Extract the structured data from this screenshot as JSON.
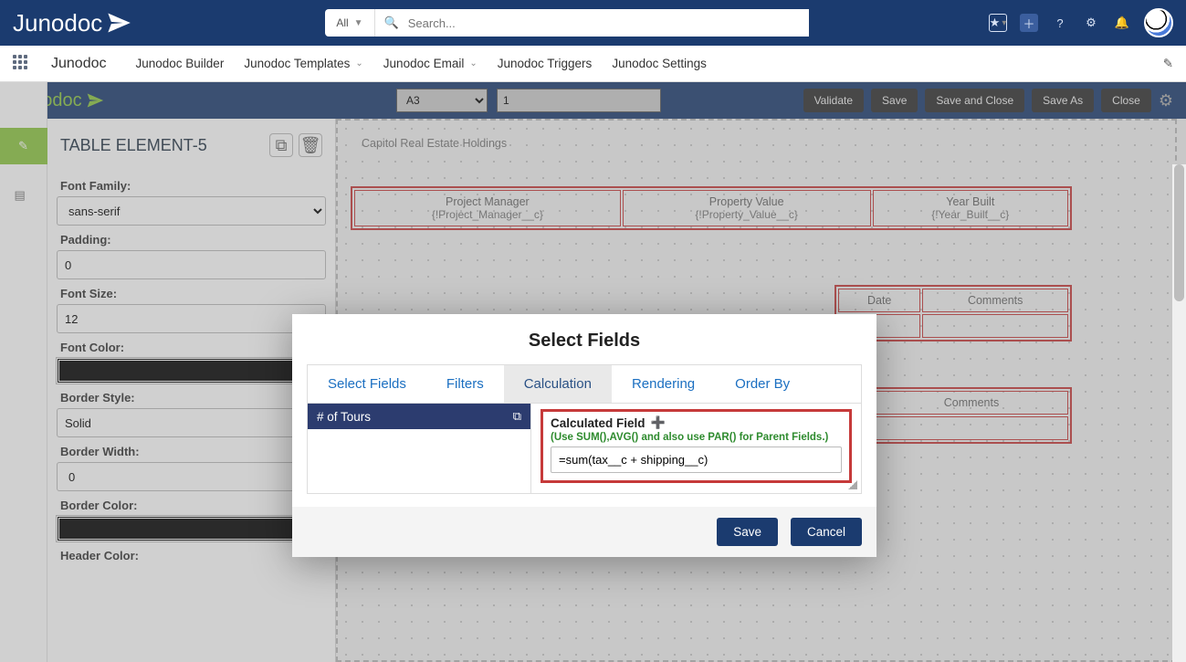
{
  "topbar": {
    "brand": "Junodoc",
    "search_scope": "All",
    "search_placeholder": "Search..."
  },
  "navbar2": {
    "brand": "Junodoc",
    "items": [
      "Junodoc Builder",
      "Junodoc Templates",
      "Junodoc Email",
      "Junodoc Triggers",
      "Junodoc Settings"
    ]
  },
  "strip": {
    "doc_brand": "Junodoc",
    "cell_ref": "A3",
    "cell_value": "1",
    "buttons": {
      "validate": "Validate",
      "save": "Save",
      "save_close": "Save and Close",
      "save_as": "Save As",
      "close": "Close"
    }
  },
  "panel": {
    "title": "TABLE ELEMENT-5",
    "font_family_label": "Font Family:",
    "font_family_value": "sans-serif",
    "padding_label": "Padding:",
    "padding_value": "0",
    "font_size_label": "Font Size:",
    "font_size_value": "12",
    "font_color_label": "Font Color:",
    "border_style_label": "Border Style:",
    "border_style_value": "Solid",
    "border_width_label": "Border Width:",
    "border_width_value": "0",
    "border_color_label": "Border Color:",
    "header_color_label": "Header Color:"
  },
  "canvas": {
    "caption": "Capitol Real Estate Holdings",
    "cols": [
      {
        "h": "Project Manager",
        "s": "{!Project_Manager__c}"
      },
      {
        "h": "Property Value",
        "s": "{!Property_Value__c}"
      },
      {
        "h": "Year Built",
        "s": "{!Year_Built__c}"
      }
    ],
    "row2": {
      "date": "Date",
      "comments": "Comments"
    },
    "row3": {
      "comments": "Comments"
    }
  },
  "modal": {
    "title": "Select Fields",
    "tabs": [
      "Select Fields",
      "Filters",
      "Calculation",
      "Rendering",
      "Order By"
    ],
    "field_name": "# of Tours",
    "calc_label": "Calculated Field",
    "calc_hint": "(Use SUM(),AVG() and also use PAR() for Parent Fields.)",
    "calc_value": "=sum(tax__c + shipping__c)",
    "save": "Save",
    "cancel": "Cancel"
  }
}
